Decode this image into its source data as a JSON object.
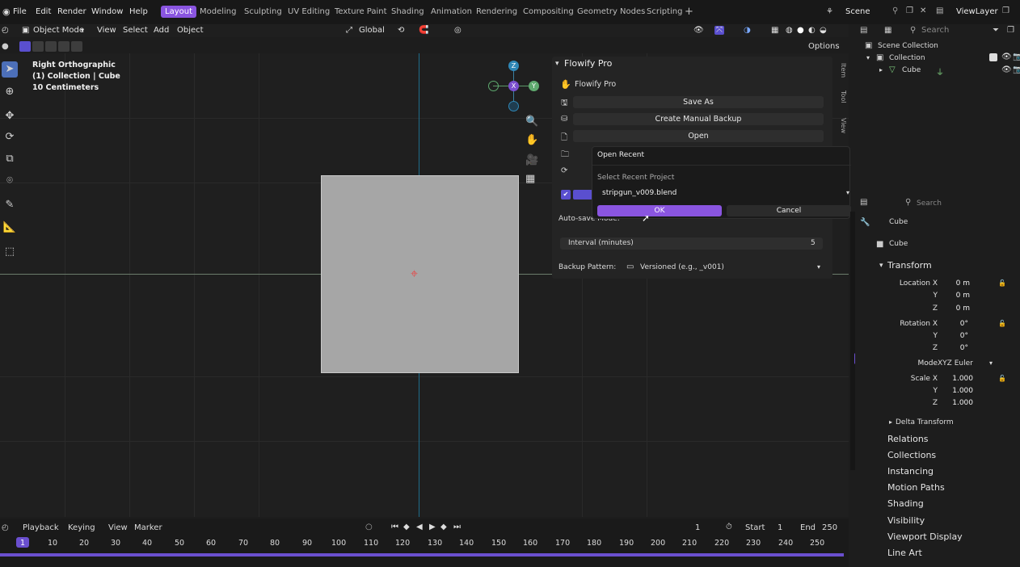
{
  "topbar": {
    "menus": [
      "File",
      "Edit",
      "Render",
      "Window",
      "Help"
    ],
    "workspaces": [
      "Layout",
      "Modeling",
      "Sculpting",
      "UV Editing",
      "Texture Paint",
      "Shading",
      "Animation",
      "Rendering",
      "Compositing",
      "Geometry Nodes",
      "Scripting"
    ],
    "add_tab": "+",
    "scene_label": "Scene",
    "viewlayer_label": "ViewLayer"
  },
  "viewport_header": {
    "mode": "Object Mode",
    "menus": [
      "View",
      "Select",
      "Add",
      "Object"
    ],
    "transform": "Global",
    "options": "Options"
  },
  "viewport": {
    "info_line1": "Right Orthographic",
    "info_line2": "(1) Collection | Cube",
    "info_line3": "10 Centimeters",
    "gizmo_z": "Z",
    "gizmo_x": "X",
    "gizmo_y": "Y"
  },
  "npanel": {
    "title": "Flowify Pro",
    "subtitle": "Flowify Pro",
    "save_as": "Save As",
    "manual_backup": "Create Manual Backup",
    "open": "Open",
    "autosave_label": "Auto-save Mode:",
    "interval_label": "Interval (minutes)",
    "interval_value": "5",
    "backup_pattern_label": "Backup Pattern:",
    "backup_pattern_value": "Versioned (e.g., _v001)",
    "tabs": [
      "Item",
      "Tool",
      "View"
    ]
  },
  "popup": {
    "title": "Open Recent",
    "select_label": "Select Recent Project",
    "selected_file": "stripgun_v009.blend",
    "ok": "OK",
    "cancel": "Cancel"
  },
  "outliner": {
    "search_placeholder": "Search",
    "scene_collection": "Scene Collection",
    "collection": "Collection",
    "cube": "Cube"
  },
  "properties": {
    "search_placeholder": "Search",
    "object_name": "Cube",
    "object_field": "Cube",
    "transform": "Transform",
    "location_x_label": "Location X",
    "location_x": "0 m",
    "location_y": "0 m",
    "location_z": "0 m",
    "rotation_x_label": "Rotation X",
    "rotation_x": "0°",
    "rotation_y": "0°",
    "rotation_z": "0°",
    "mode_label": "Mode",
    "mode_value": "XYZ Euler",
    "scale_x_label": "Scale X",
    "scale_x": "1.000",
    "scale_y": "1.000",
    "scale_z": "1.000",
    "y_label": "Y",
    "z_label": "Z",
    "delta_transform": "Delta Transform",
    "sections": [
      "Relations",
      "Collections",
      "Instancing",
      "Motion Paths",
      "Shading",
      "Visibility",
      "Viewport Display",
      "Line Art"
    ]
  },
  "timeline": {
    "menus": [
      "Playback",
      "Keying",
      "View",
      "Marker"
    ],
    "current_frame": "1",
    "start_label": "Start",
    "start_value": "1",
    "end_label": "End",
    "end_value": "250",
    "ticks": [
      "1",
      "10",
      "20",
      "30",
      "40",
      "50",
      "60",
      "70",
      "80",
      "90",
      "100",
      "110",
      "120",
      "130",
      "140",
      "150",
      "160",
      "170",
      "180",
      "190",
      "200",
      "210",
      "220",
      "230",
      "240",
      "250"
    ]
  },
  "colors": {
    "accent": "#8a55e0",
    "axis_blue": "#1f6c8a"
  }
}
